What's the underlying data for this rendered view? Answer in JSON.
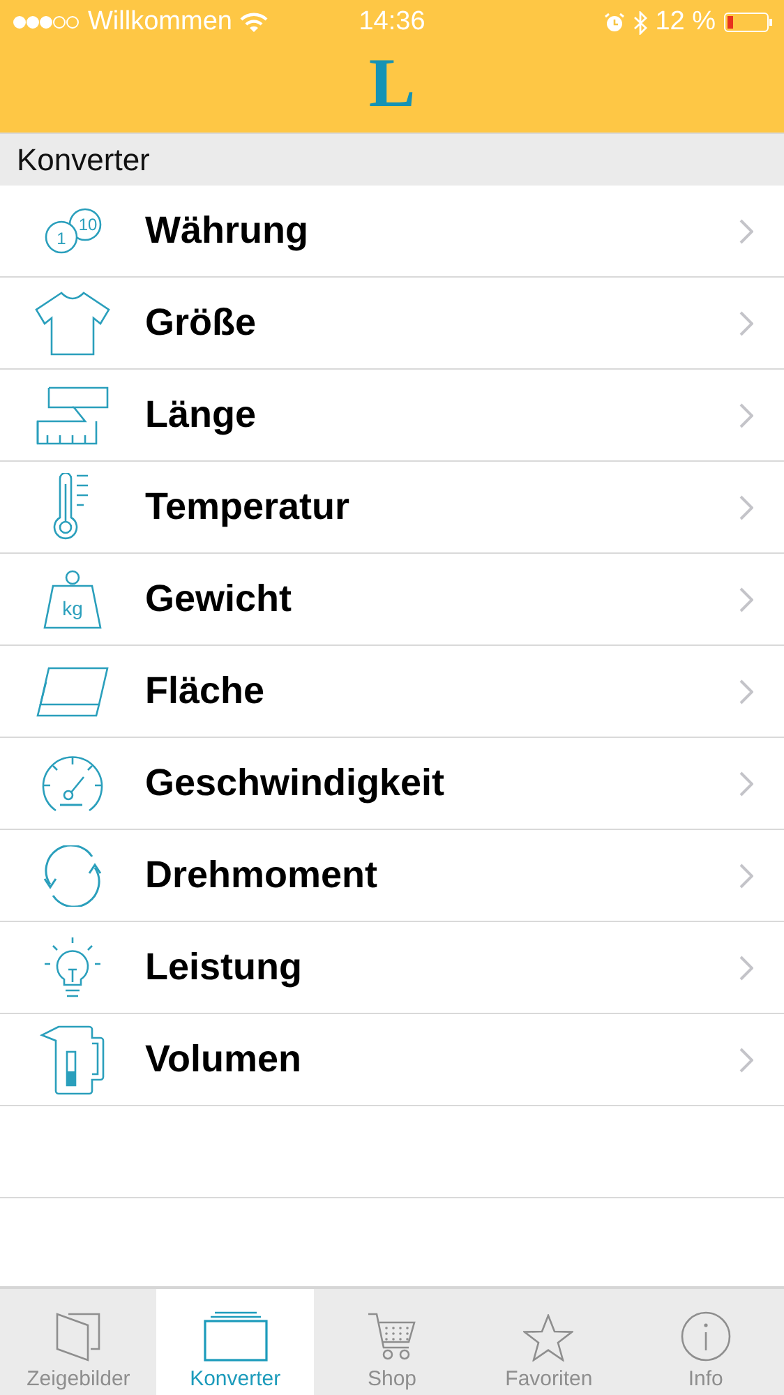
{
  "status_bar": {
    "carrier": "Willkommen",
    "time": "14:36",
    "battery": "12 %"
  },
  "header": {
    "logo": "L"
  },
  "section": {
    "title": "Konverter"
  },
  "items": [
    {
      "label": "Währung",
      "kind": "coins",
      "icon_labels": [
        "1",
        "10"
      ]
    },
    {
      "label": "Größe",
      "kind": "shirt"
    },
    {
      "label": "Länge",
      "kind": "tape"
    },
    {
      "label": "Temperatur",
      "kind": "thermometer"
    },
    {
      "label": "Gewicht",
      "kind": "weight",
      "icon_labels": [
        "kg"
      ]
    },
    {
      "label": "Fläche",
      "kind": "area"
    },
    {
      "label": "Geschwindigkeit",
      "kind": "speedometer"
    },
    {
      "label": "Drehmoment",
      "kind": "rotate"
    },
    {
      "label": "Leistung",
      "kind": "bulb"
    },
    {
      "label": "Volumen",
      "kind": "kettle"
    }
  ],
  "tabs": [
    {
      "label": "Zeigebilder",
      "kind": "book",
      "selected": false
    },
    {
      "label": "Konverter",
      "kind": "stack",
      "selected": true
    },
    {
      "label": "Shop",
      "kind": "cart",
      "selected": false
    },
    {
      "label": "Favoriten",
      "kind": "star",
      "selected": false
    },
    {
      "label": "Info",
      "kind": "info",
      "selected": false
    }
  ]
}
